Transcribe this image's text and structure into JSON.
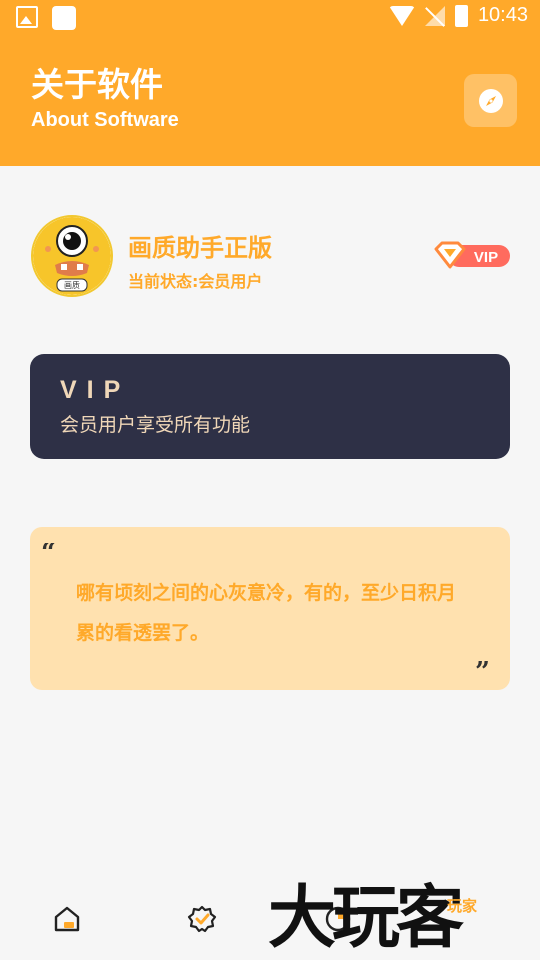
{
  "status_bar": {
    "time": "10:43"
  },
  "header": {
    "title": "关于软件",
    "subtitle": "About Software"
  },
  "app_info": {
    "name": "画质助手正版",
    "status": "当前状态:会员用户",
    "avatar_label": "画质",
    "badge_label": "VIP"
  },
  "vip_card": {
    "title": "VIP",
    "description": "会员用户享受所有功能"
  },
  "quote": {
    "text": "哪有顷刻之间的心灰意冷，有的，至少日积月累的看透罢了。"
  },
  "watermark": {
    "text": "大玩客",
    "small_text": "玩家"
  },
  "colors": {
    "accent": "#ffa92a",
    "card_dark": "#2e3046",
    "card_gold_text": "#f0d7b8",
    "quote_bg": "#ffe1af",
    "background": "#f6f6f6"
  },
  "icons": {
    "header_action": "compass-icon",
    "nav": [
      "home-icon",
      "verified-badge-icon",
      "stats-pie-icon"
    ]
  }
}
